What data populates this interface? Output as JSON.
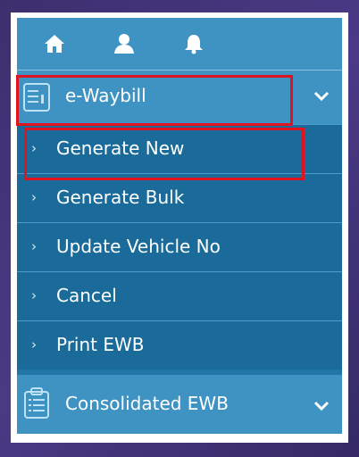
{
  "topbar": {
    "icons": [
      "home-icon",
      "user-icon",
      "bell-icon"
    ]
  },
  "sections": {
    "ewaybill": {
      "label": "e-Waybill",
      "icon": "document-list-icon"
    },
    "consolidated": {
      "label": "Consolidated EWB",
      "icon": "clipboard-list-icon"
    }
  },
  "submenu": [
    {
      "label": "Generate New"
    },
    {
      "label": "Generate Bulk"
    },
    {
      "label": "Update Vehicle No"
    },
    {
      "label": "Cancel"
    },
    {
      "label": "Print EWB"
    }
  ],
  "colors": {
    "topbar": "#3e93c2",
    "submenu": "#1a6b9a",
    "highlight": "#e0141e"
  }
}
